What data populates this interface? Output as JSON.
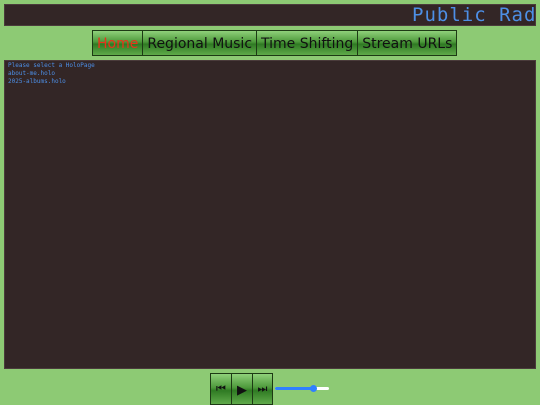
{
  "header": {
    "title": "Public Radio"
  },
  "nav": {
    "tabs": [
      {
        "label": "Home",
        "active": true
      },
      {
        "label": "Regional Music",
        "active": false
      },
      {
        "label": "Time Shifting",
        "active": false
      },
      {
        "label": "Stream URLs",
        "active": false
      }
    ]
  },
  "content": {
    "prompt": "Please select a HoloPage",
    "links": [
      "about-me.holo",
      "2025-albums.holo"
    ]
  },
  "player": {
    "prev_icon": "⏮",
    "play_icon": "▶",
    "next_icon": "⏭",
    "volume": 0.7
  },
  "colors": {
    "background": "#8dca74",
    "panel": "#332626",
    "text_accent": "#4d8fe6",
    "active_tab": "#e8321c"
  }
}
